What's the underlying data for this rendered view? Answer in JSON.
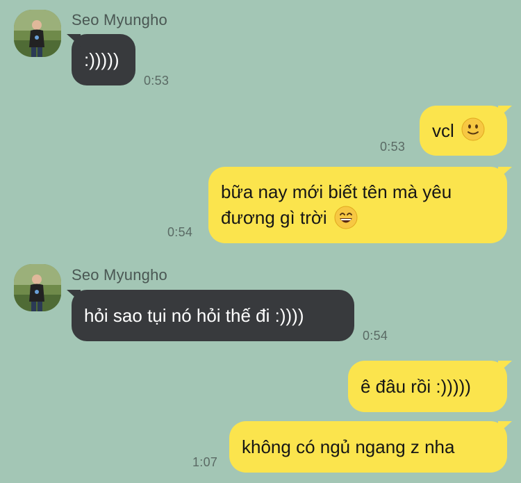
{
  "contact": {
    "name": "Seo Myungho"
  },
  "messages": [
    {
      "id": "m1",
      "direction": "in",
      "text": ":)))))",
      "time": "0:53"
    },
    {
      "id": "m2",
      "direction": "out",
      "text": "vcl",
      "emoji": "slightly-smiling-face-icon",
      "time": "0:53"
    },
    {
      "id": "m3",
      "direction": "out",
      "text": "bữa nay mới biết tên mà yêu\nđương gì trời",
      "emoji": "grinning-face-icon",
      "time": "0:54"
    },
    {
      "id": "m4",
      "direction": "in",
      "text": "hỏi sao tụi nó hỏi thế đi :))))",
      "time": "0:54"
    },
    {
      "id": "m5",
      "direction": "out",
      "text": "ê đâu rồi :)))))",
      "time": ""
    },
    {
      "id": "m6",
      "direction": "out",
      "text": "không có ngủ ngang z nha",
      "time": "1:07"
    }
  ],
  "colors": {
    "background": "#a3c6b5",
    "incoming_bubble": "#383a3d",
    "outgoing_bubble": "#fbe44d"
  }
}
